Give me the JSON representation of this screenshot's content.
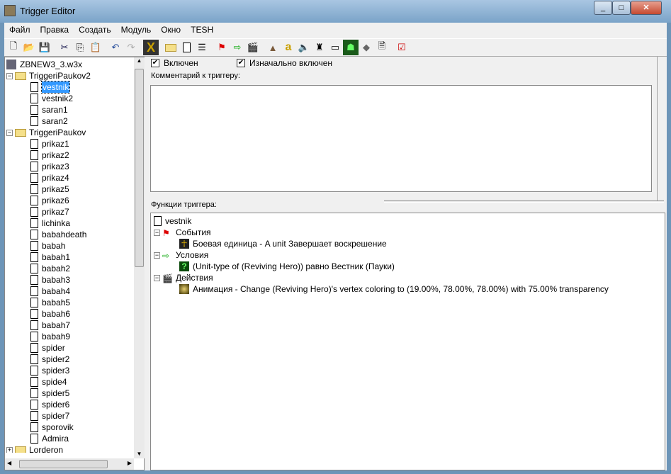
{
  "window": {
    "title": "Trigger Editor"
  },
  "menu": [
    "Файл",
    "Правка",
    "Создать",
    "Модуль",
    "Окно",
    "TESH"
  ],
  "toolbar_icons": [
    "new-icon",
    "open-icon",
    "save-icon",
    "cut-icon",
    "copy-icon",
    "paste-icon",
    "undo-icon",
    "redo-icon",
    "delete-icon",
    "folder-icon",
    "trigger-icon",
    "comment-icon",
    "event-icon",
    "condition-icon",
    "action-icon",
    "terrain-icon",
    "text-icon",
    "sound-icon",
    "object-icon",
    "camera-icon",
    "ai-icon",
    "import-icon",
    "script-icon",
    "test-icon"
  ],
  "tree": {
    "root": "ZBNEW3_3.w3x",
    "folders": [
      {
        "name": "TriggeriPaukov2",
        "items": [
          "vestnik",
          "vestnik2",
          "saran1",
          "saran2"
        ]
      },
      {
        "name": "TriggeriPaukov",
        "items": [
          "prikaz1",
          "prikaz2",
          "prikaz3",
          "prikaz4",
          "prikaz5",
          "prikaz6",
          "prikaz7",
          "lichinka",
          "babahdeath",
          "babah",
          "babah1",
          "babah2",
          "babah3",
          "babah4",
          "babah5",
          "babah6",
          "babah7",
          "babah9",
          "spider",
          "spider2",
          "spider3",
          "spide4",
          "spider5",
          "spider6",
          "spider7",
          "sporovik",
          "Admira"
        ]
      },
      {
        "name": "Lorderon",
        "items": []
      }
    ],
    "selected": "vestnik"
  },
  "trigger": {
    "enabled_label": "Включен",
    "enabled": true,
    "initially_on_label": "Изначально включен",
    "initially_on": true,
    "comment_label": "Комментарий к триггеру:",
    "comment": "",
    "functions_label": "Функции триггера:",
    "name": "vestnik",
    "events_label": "События",
    "events": [
      "Боевая единица - A unit Завершает воскрешение"
    ],
    "conditions_label": "Условия",
    "conditions": [
      "(Unit-type of (Reviving Hero)) равно Вестник (Пауки)"
    ],
    "actions_label": "Действия",
    "actions": [
      "Анимация - Change (Reviving Hero)'s vertex coloring to (19.00%, 78.00%, 78.00%) with 75.00% transparency"
    ]
  }
}
